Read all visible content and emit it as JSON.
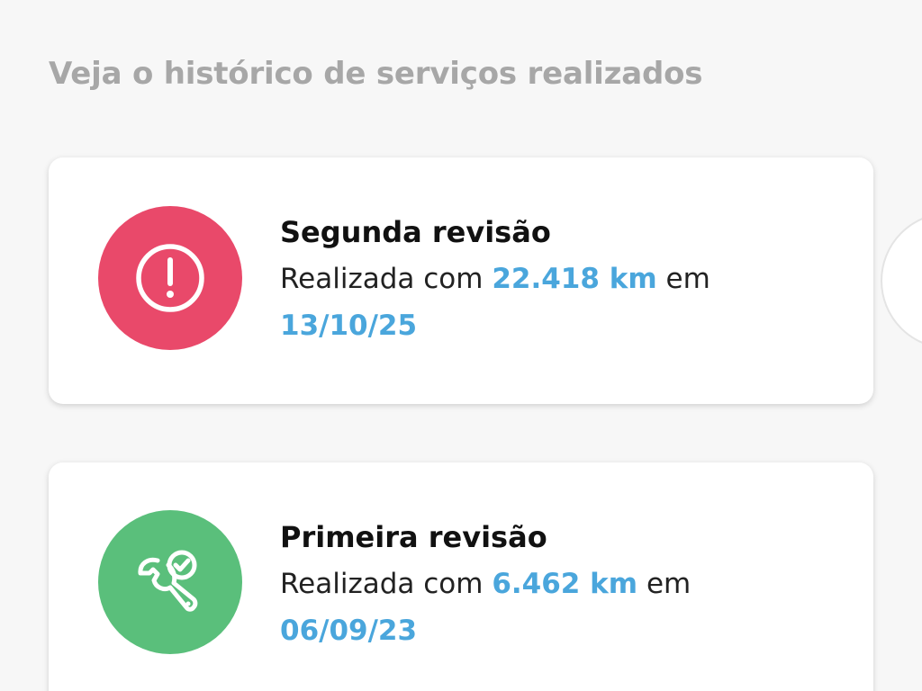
{
  "header": {
    "title": "Veja o histórico de serviços realizados"
  },
  "services": [
    {
      "title": "Segunda revisão",
      "prefix": "Realizada com ",
      "km": "22.418 km",
      "suffix": " em",
      "date": "13/10/25",
      "status": "alert",
      "icon": "exclamation-circle-icon",
      "color": "#e9496a"
    },
    {
      "title": "Primeira revisão",
      "prefix": "Realizada com ",
      "km": "6.462 km",
      "suffix": " em",
      "date": "06/09/23",
      "status": "done",
      "icon": "wrench-check-icon",
      "color": "#5abf7b"
    }
  ],
  "colors": {
    "accent": "#4aa6dc",
    "alert": "#e9496a",
    "success": "#5abf7b",
    "title_gray": "#a7a7a7"
  }
}
